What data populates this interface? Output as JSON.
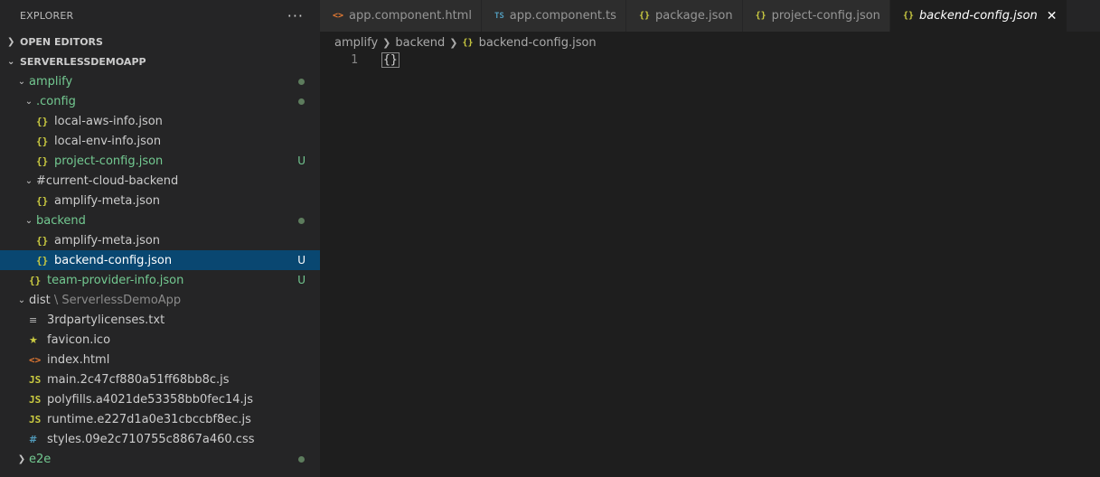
{
  "sidebar": {
    "title": "EXPLORER",
    "more": "···",
    "open_editors": "OPEN EDITORS",
    "project": "SERVERLESSDEMOAPP",
    "tree": [
      {
        "label": "amplify",
        "indent": 0,
        "type": "folder",
        "open": true,
        "color": "green",
        "dot": true
      },
      {
        "label": ".config",
        "indent": 1,
        "type": "folder",
        "open": true,
        "color": "green",
        "dot": true
      },
      {
        "label": "local-aws-info.json",
        "indent": 2,
        "type": "json",
        "color": "gray"
      },
      {
        "label": "local-env-info.json",
        "indent": 2,
        "type": "json",
        "color": "gray"
      },
      {
        "label": "project-config.json",
        "indent": 2,
        "type": "json",
        "color": "green",
        "status": "U"
      },
      {
        "label": "#current-cloud-backend",
        "indent": 1,
        "type": "folder",
        "open": true,
        "color": "gray"
      },
      {
        "label": "amplify-meta.json",
        "indent": 2,
        "type": "json",
        "color": "gray"
      },
      {
        "label": "backend",
        "indent": 1,
        "type": "folder",
        "open": true,
        "color": "green",
        "dot": true
      },
      {
        "label": "amplify-meta.json",
        "indent": 2,
        "type": "json",
        "color": "gray"
      },
      {
        "label": "backend-config.json",
        "indent": 2,
        "type": "json",
        "color": "white",
        "status": "U",
        "selected": true
      },
      {
        "label": "team-provider-info.json",
        "indent": 1,
        "type": "json",
        "color": "green",
        "status": "U"
      },
      {
        "label": "dist",
        "suffix": " \\ ServerlessDemoApp",
        "indent": 0,
        "type": "folder",
        "open": true,
        "color": "gray"
      },
      {
        "label": "3rdpartylicenses.txt",
        "indent": 1,
        "type": "txt",
        "color": "gray"
      },
      {
        "label": "favicon.ico",
        "indent": 1,
        "type": "star",
        "color": "gray"
      },
      {
        "label": "index.html",
        "indent": 1,
        "type": "html",
        "color": "gray"
      },
      {
        "label": "main.2c47cf880a51ff68bb8c.js",
        "indent": 1,
        "type": "js",
        "color": "gray"
      },
      {
        "label": "polyfills.a4021de53358bb0fec14.js",
        "indent": 1,
        "type": "js",
        "color": "gray"
      },
      {
        "label": "runtime.e227d1a0e31cbccbf8ec.js",
        "indent": 1,
        "type": "js",
        "color": "gray"
      },
      {
        "label": "styles.09e2c710755c8867a460.css",
        "indent": 1,
        "type": "css",
        "color": "gray"
      },
      {
        "label": "e2e",
        "indent": 0,
        "type": "folder",
        "open": false,
        "color": "green",
        "dot": true
      }
    ]
  },
  "tabs": [
    {
      "label": "app.component.html",
      "icon": "html"
    },
    {
      "label": "app.component.ts",
      "icon": "ts"
    },
    {
      "label": "package.json",
      "icon": "json"
    },
    {
      "label": "project-config.json",
      "icon": "json"
    },
    {
      "label": "backend-config.json",
      "icon": "json",
      "active": true
    }
  ],
  "breadcrumb": [
    "amplify",
    "backend",
    "backend-config.json"
  ],
  "editor": {
    "lines": [
      {
        "number": "1",
        "text": "{}"
      }
    ]
  },
  "colors": {
    "green": "#73c991",
    "json_icon": "#cbcb41",
    "html_icon": "#e37933",
    "selection": "#094771"
  },
  "icons": {
    "json": "{}",
    "html": "<>",
    "ts": "TS",
    "js": "JS",
    "css": "#",
    "star": "★",
    "txt": "≡",
    "close": "✕",
    "chevron_down": "⌄",
    "chevron_right": "›"
  }
}
